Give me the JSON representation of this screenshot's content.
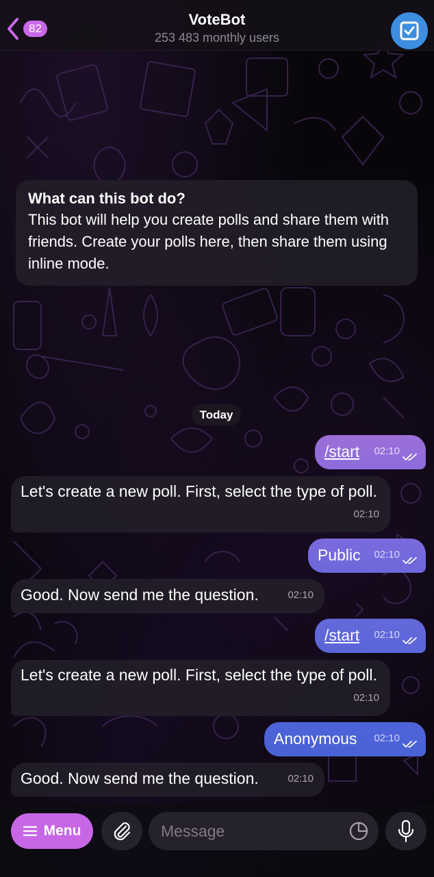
{
  "header": {
    "back_count": "82",
    "title": "VoteBot",
    "subtitle": "253 483 monthly users"
  },
  "info": {
    "title": "What can this bot do?",
    "body": "This bot will help you create polls and share them with friends. Create your polls here, then share them using inline mode."
  },
  "date_label": "Today",
  "messages": [
    {
      "dir": "out",
      "text": "/start",
      "time": "02:10",
      "command": true
    },
    {
      "dir": "in",
      "text": "Let's create a new poll. First, select the type of poll.",
      "time": "02:10"
    },
    {
      "dir": "out",
      "text": "Public",
      "time": "02:10"
    },
    {
      "dir": "in",
      "text": "Good. Now send me the question.",
      "time": "02:10"
    },
    {
      "dir": "out",
      "text": "/start",
      "time": "02:10",
      "command": true
    },
    {
      "dir": "in",
      "text": "Let's create a new poll. First, select the type of poll.",
      "time": "02:10"
    },
    {
      "dir": "out",
      "text": "Anonymous",
      "time": "02:10"
    },
    {
      "dir": "in",
      "text": "Good. Now send me the question.",
      "time": "02:10"
    }
  ],
  "composer": {
    "menu_label": "Menu",
    "placeholder": "Message"
  },
  "colors": {
    "accent": "#c968e8",
    "app_button": "#3d8ee0",
    "bubble_out_top": "#9b6fe0",
    "bubble_out_bottom": "#4f63d8"
  },
  "icons": {
    "back": "chevron-left-icon",
    "app": "checkbox-icon",
    "menu": "hamburger-icon",
    "attach": "paperclip-icon",
    "sticker": "sticker-icon",
    "mic": "microphone-icon",
    "read": "double-check-icon"
  }
}
